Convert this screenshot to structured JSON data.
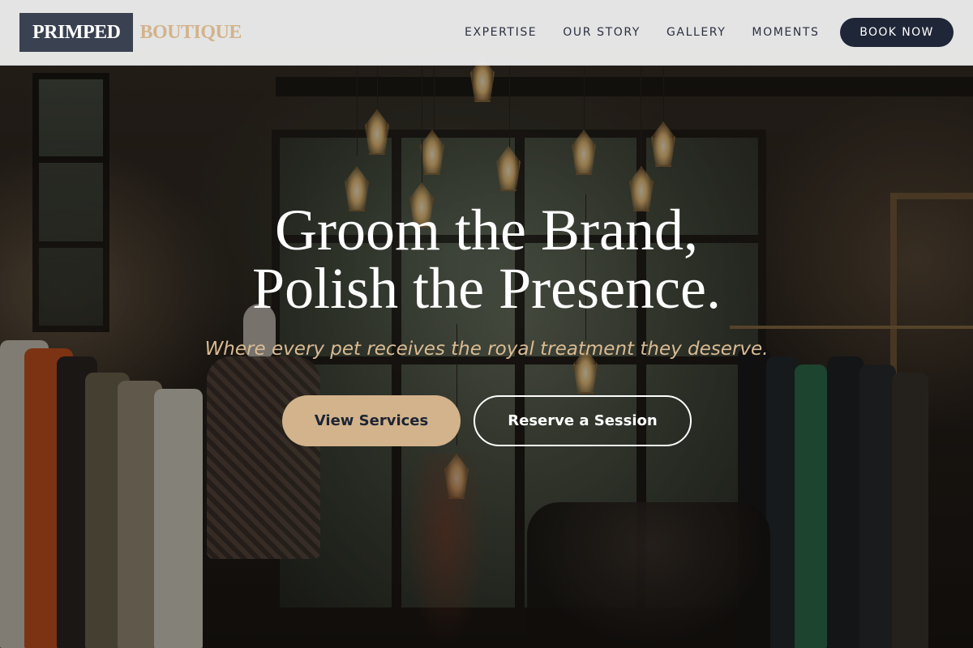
{
  "brand": {
    "primary": "PRIMPED",
    "secondary": "BOUTIQUE"
  },
  "nav": {
    "links": [
      "EXPERTISE",
      "OUR STORY",
      "GALLERY",
      "MOMENTS"
    ],
    "cta_label": "BOOK NOW"
  },
  "hero": {
    "title_line1": "Groom the Brand,",
    "title_line2": "Polish the Presence.",
    "subtitle": "Where every pet receives the royal treatment they deserve.",
    "primary_button": "View Services",
    "secondary_button": "Reserve a Session"
  },
  "colors": {
    "navy": "#1f2638",
    "logo_block": "#3a4150",
    "accent_tan": "#d2b38c",
    "navbar_bg": "#ececec",
    "text_white": "#ffffff"
  }
}
